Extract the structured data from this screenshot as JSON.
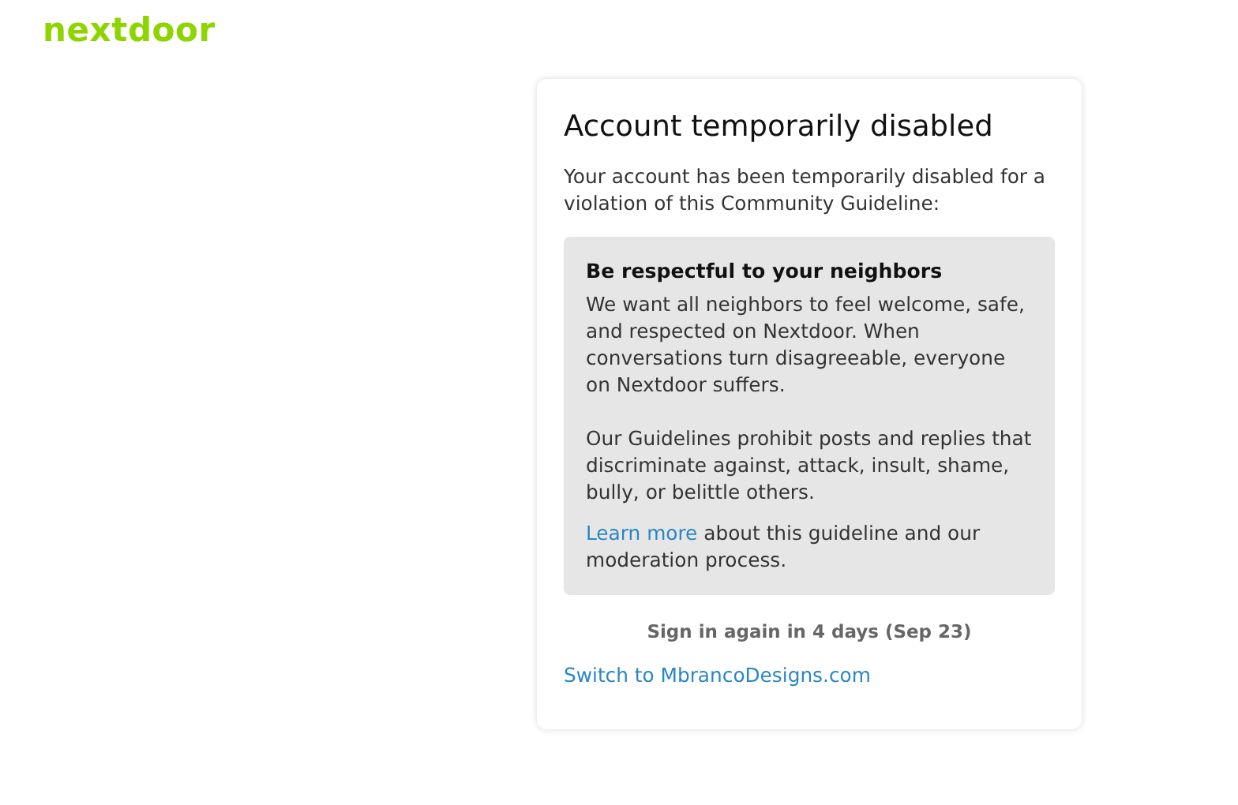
{
  "logo": "nextdoor",
  "card": {
    "title": "Account temporarily disabled",
    "intro": "Your account has been temporarily disabled for a violation of this Community Guideline:",
    "guideline": {
      "heading": "Be respectful to your neighbors",
      "paragraphs": [
        "We want all neighbors to feel welcome, safe, and respected on Nextdoor. When conversations turn disagreeable, everyone on Nextdoor suffers.",
        "Our Guidelines prohibit posts and replies that discriminate against, attack, insult, shame, bully, or belittle others."
      ],
      "learn_more": {
        "link": "Learn more",
        "text": "about this guideline and our moderation process."
      }
    },
    "sign_in_notice": "Sign in again in 4 days (Sep 23)",
    "switch_link": "Switch to MbrancoDesigns.com"
  }
}
